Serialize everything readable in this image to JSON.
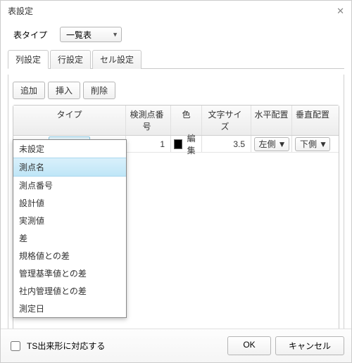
{
  "window": {
    "title": "表設定"
  },
  "typeRow": {
    "label": "表タイプ",
    "value": "一覧表"
  },
  "tabs": [
    {
      "label": "列設定",
      "active": true
    },
    {
      "label": "行設定",
      "active": false
    },
    {
      "label": "セル設定",
      "active": false
    }
  ],
  "toolbar": {
    "add": "追加",
    "insert": "挿入",
    "delete": "削除"
  },
  "grid": {
    "headers": {
      "type": "タイプ",
      "no": "検測点番号",
      "color": "色",
      "size": "文字サイズ",
      "ha": "水平配置",
      "va": "垂直配置"
    },
    "row": {
      "type": "測点名",
      "no": "1",
      "colorHex": "#000000",
      "colorEdit": "編集",
      "size": "3.5",
      "ha": "左側",
      "va": "下側"
    }
  },
  "typeOptions": [
    "未設定",
    "測点名",
    "測点番号",
    "設計値",
    "実測値",
    "差",
    "規格値との差",
    "管理基準値との差",
    "社内管理値との差",
    "測定日"
  ],
  "typeSelected": "測点名",
  "footer": {
    "checkbox": "TS出来形に対応する",
    "ok": "OK",
    "cancel": "キャンセル"
  }
}
